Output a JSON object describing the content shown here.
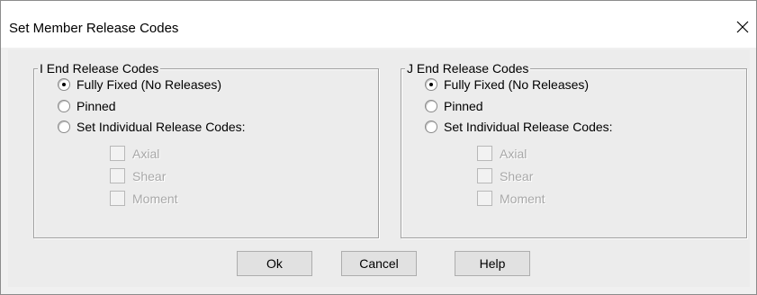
{
  "dialog": {
    "title": "Set Member Release Codes",
    "close_icon": "close-x-icon"
  },
  "i_end": {
    "legend": "I End Release Codes",
    "options": [
      {
        "label": "Fully Fixed (No Releases)",
        "checked": true
      },
      {
        "label": "Pinned",
        "checked": false
      },
      {
        "label": "Set Individual Release Codes:",
        "checked": false
      }
    ],
    "checkboxes": [
      {
        "label": "Axial",
        "checked": false,
        "enabled": false
      },
      {
        "label": "Shear",
        "checked": false,
        "enabled": false
      },
      {
        "label": "Moment",
        "checked": false,
        "enabled": false
      }
    ]
  },
  "j_end": {
    "legend": "J End Release Codes",
    "options": [
      {
        "label": "Fully Fixed (No Releases)",
        "checked": true
      },
      {
        "label": "Pinned",
        "checked": false
      },
      {
        "label": "Set Individual Release Codes:",
        "checked": false
      }
    ],
    "checkboxes": [
      {
        "label": "Axial",
        "checked": false,
        "enabled": false
      },
      {
        "label": "Shear",
        "checked": false,
        "enabled": false
      },
      {
        "label": "Moment",
        "checked": false,
        "enabled": false
      }
    ]
  },
  "buttons": {
    "ok": "Ok",
    "cancel": "Cancel",
    "help": "Help"
  }
}
